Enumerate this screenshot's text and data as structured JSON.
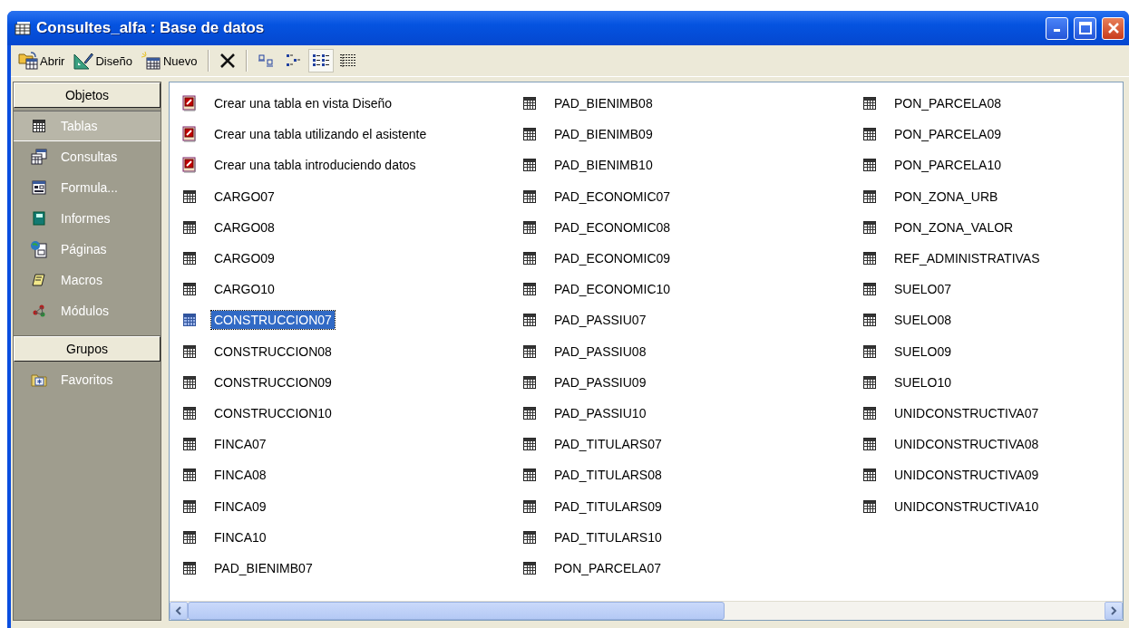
{
  "window": {
    "title": "Consultes_alfa : Base de datos"
  },
  "toolbar": [
    {
      "kind": "open",
      "label": "Abrir"
    },
    {
      "kind": "design",
      "label": "Diseño"
    },
    {
      "kind": "new",
      "label": "Nuevo"
    },
    {
      "kind": "delete"
    },
    {
      "kind": "large",
      "selected": false
    },
    {
      "kind": "small",
      "selected": false
    },
    {
      "kind": "list",
      "selected": true
    },
    {
      "kind": "details",
      "selected": false
    }
  ],
  "sidebar": {
    "objects_header": "Objetos",
    "items": [
      {
        "kind": "table",
        "label": "Tablas",
        "selected": true
      },
      {
        "kind": "query",
        "label": "Consultas",
        "selected": false
      },
      {
        "kind": "form",
        "label": "Formula...",
        "selected": false
      },
      {
        "kind": "report",
        "label": "Informes",
        "selected": false
      },
      {
        "kind": "page",
        "label": "Páginas",
        "selected": false
      },
      {
        "kind": "macro",
        "label": "Macros",
        "selected": false
      },
      {
        "kind": "module",
        "label": "Módulos",
        "selected": false
      }
    ],
    "groups_header": "Grupos",
    "groups": [
      {
        "kind": "favorites",
        "label": "Favoritos",
        "selected": false
      }
    ]
  },
  "items": [
    {
      "kind": "wizard",
      "label": "Crear una tabla en vista Diseño",
      "selected": false
    },
    {
      "kind": "wizard",
      "label": "Crear una tabla utilizando el asistente",
      "selected": false
    },
    {
      "kind": "wizard",
      "label": "Crear una tabla introduciendo datos",
      "selected": false
    },
    {
      "kind": "table",
      "label": "CARGO07",
      "selected": false
    },
    {
      "kind": "table",
      "label": "CARGO08",
      "selected": false
    },
    {
      "kind": "table",
      "label": "CARGO09",
      "selected": false
    },
    {
      "kind": "table",
      "label": "CARGO10",
      "selected": false
    },
    {
      "kind": "table",
      "label": "CONSTRUCCION07",
      "selected": true
    },
    {
      "kind": "table",
      "label": "CONSTRUCCION08",
      "selected": false
    },
    {
      "kind": "table",
      "label": "CONSTRUCCION09",
      "selected": false
    },
    {
      "kind": "table",
      "label": "CONSTRUCCION10",
      "selected": false
    },
    {
      "kind": "table",
      "label": "FINCA07",
      "selected": false
    },
    {
      "kind": "table",
      "label": "FINCA08",
      "selected": false
    },
    {
      "kind": "table",
      "label": "FINCA09",
      "selected": false
    },
    {
      "kind": "table",
      "label": "FINCA10",
      "selected": false
    },
    {
      "kind": "table",
      "label": "PAD_BIENIMB07",
      "selected": false
    },
    {
      "kind": "table",
      "label": "PAD_BIENIMB08",
      "selected": false
    },
    {
      "kind": "table",
      "label": "PAD_BIENIMB09",
      "selected": false
    },
    {
      "kind": "table",
      "label": "PAD_BIENIMB10",
      "selected": false
    },
    {
      "kind": "table",
      "label": "PAD_ECONOMIC07",
      "selected": false
    },
    {
      "kind": "table",
      "label": "PAD_ECONOMIC08",
      "selected": false
    },
    {
      "kind": "table",
      "label": "PAD_ECONOMIC09",
      "selected": false
    },
    {
      "kind": "table",
      "label": "PAD_ECONOMIC10",
      "selected": false
    },
    {
      "kind": "table",
      "label": "PAD_PASSIU07",
      "selected": false
    },
    {
      "kind": "table",
      "label": "PAD_PASSIU08",
      "selected": false
    },
    {
      "kind": "table",
      "label": "PAD_PASSIU09",
      "selected": false
    },
    {
      "kind": "table",
      "label": "PAD_PASSIU10",
      "selected": false
    },
    {
      "kind": "table",
      "label": "PAD_TITULARS07",
      "selected": false
    },
    {
      "kind": "table",
      "label": "PAD_TITULARS08",
      "selected": false
    },
    {
      "kind": "table",
      "label": "PAD_TITULARS09",
      "selected": false
    },
    {
      "kind": "table",
      "label": "PAD_TITULARS10",
      "selected": false
    },
    {
      "kind": "table",
      "label": "PON_PARCELA07",
      "selected": false
    },
    {
      "kind": "table",
      "label": "PON_PARCELA08",
      "selected": false
    },
    {
      "kind": "table",
      "label": "PON_PARCELA09",
      "selected": false
    },
    {
      "kind": "table",
      "label": "PON_PARCELA10",
      "selected": false
    },
    {
      "kind": "table",
      "label": "PON_ZONA_URB",
      "selected": false
    },
    {
      "kind": "table",
      "label": "PON_ZONA_VALOR",
      "selected": false
    },
    {
      "kind": "table",
      "label": "REF_ADMINISTRATIVAS",
      "selected": false
    },
    {
      "kind": "table",
      "label": "SUELO07",
      "selected": false
    },
    {
      "kind": "table",
      "label": "SUELO08",
      "selected": false
    },
    {
      "kind": "table",
      "label": "SUELO09",
      "selected": false
    },
    {
      "kind": "table",
      "label": "SUELO10",
      "selected": false
    },
    {
      "kind": "table",
      "label": "UNIDCONSTRUCTIVA07",
      "selected": false
    },
    {
      "kind": "table",
      "label": "UNIDCONSTRUCTIVA08",
      "selected": false
    },
    {
      "kind": "table",
      "label": "UNIDCONSTRUCTIVA09",
      "selected": false
    },
    {
      "kind": "table",
      "label": "UNIDCONSTRUCTIVA10",
      "selected": false
    }
  ]
}
